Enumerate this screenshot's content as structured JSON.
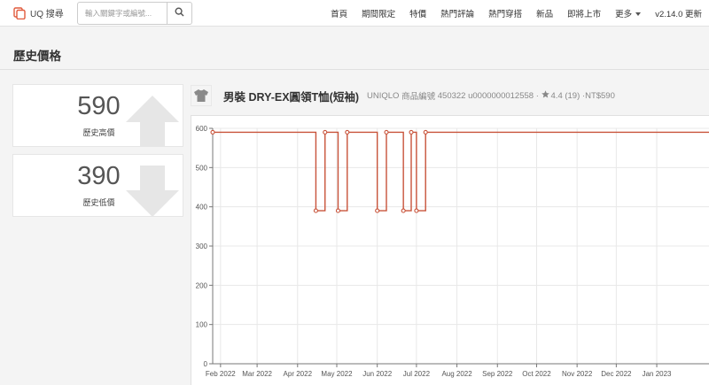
{
  "navbar": {
    "brand": "UQ 搜尋",
    "search_placeholder": "輸入關鍵字或編號...",
    "links": [
      "首頁",
      "期間限定",
      "特價",
      "熱門評論",
      "熱門穿搭",
      "新品",
      "即將上市",
      "更多",
      "v2.14.0 更新"
    ],
    "icons": {
      "brand": "uq-logo-icon",
      "search": "search-icon",
      "more": "caret-down-icon"
    }
  },
  "page": {
    "title": "歷史價格"
  },
  "stats": {
    "high": {
      "value": "590",
      "label": "歷史高價",
      "icon": "arrow-up-icon"
    },
    "low": {
      "value": "390",
      "label": "歷史低價",
      "icon": "arrow-down-icon"
    }
  },
  "product": {
    "name": "男裝 DRY-EX圓領T恤(短袖)",
    "brand": "UNIQLO",
    "id_label": "商品編號",
    "id_value": "450322 u0000000012558",
    "rating": "4.4 (19)",
    "price": "NT$590",
    "separator": "·",
    "thumb_icon": "tshirt-thumbnail-icon"
  },
  "colors": {
    "line": "#c8533a",
    "grid": "#e8e8e8",
    "axis": "#777"
  },
  "chart_data": {
    "type": "line",
    "grid": true,
    "ylim": [
      0,
      600
    ],
    "yticks": [
      "0",
      "100",
      "200",
      "300",
      "400",
      "500",
      "600"
    ],
    "xlim": [
      "2022-01-26",
      "2023-02-10"
    ],
    "xtick_labels": [
      "Feb 2022",
      "Mar 2022",
      "Apr 2022",
      "May 2022",
      "Jun 2022",
      "Jul 2022",
      "Aug 2022",
      "Sep 2022",
      "Oct 2022",
      "Nov 2022",
      "Dec 2022",
      "Jan 2023"
    ],
    "xtick_dates": [
      "2022-02-01",
      "2022-03-01",
      "2022-04-01",
      "2022-05-01",
      "2022-06-01",
      "2022-07-01",
      "2022-08-01",
      "2022-09-01",
      "2022-10-01",
      "2022-11-01",
      "2022-12-01",
      "2023-01-01"
    ],
    "step": "after",
    "points": [
      {
        "x": "2022-01-26",
        "y": 590
      },
      {
        "x": "2022-04-15",
        "y": 390
      },
      {
        "x": "2022-04-22",
        "y": 590
      },
      {
        "x": "2022-05-02",
        "y": 390
      },
      {
        "x": "2022-05-09",
        "y": 590
      },
      {
        "x": "2022-06-01",
        "y": 390
      },
      {
        "x": "2022-06-08",
        "y": 590
      },
      {
        "x": "2022-06-21",
        "y": 390
      },
      {
        "x": "2022-06-27",
        "y": 590
      },
      {
        "x": "2022-07-01",
        "y": 390
      },
      {
        "x": "2022-07-08",
        "y": 590
      }
    ],
    "line_end": "2023-02-10"
  }
}
